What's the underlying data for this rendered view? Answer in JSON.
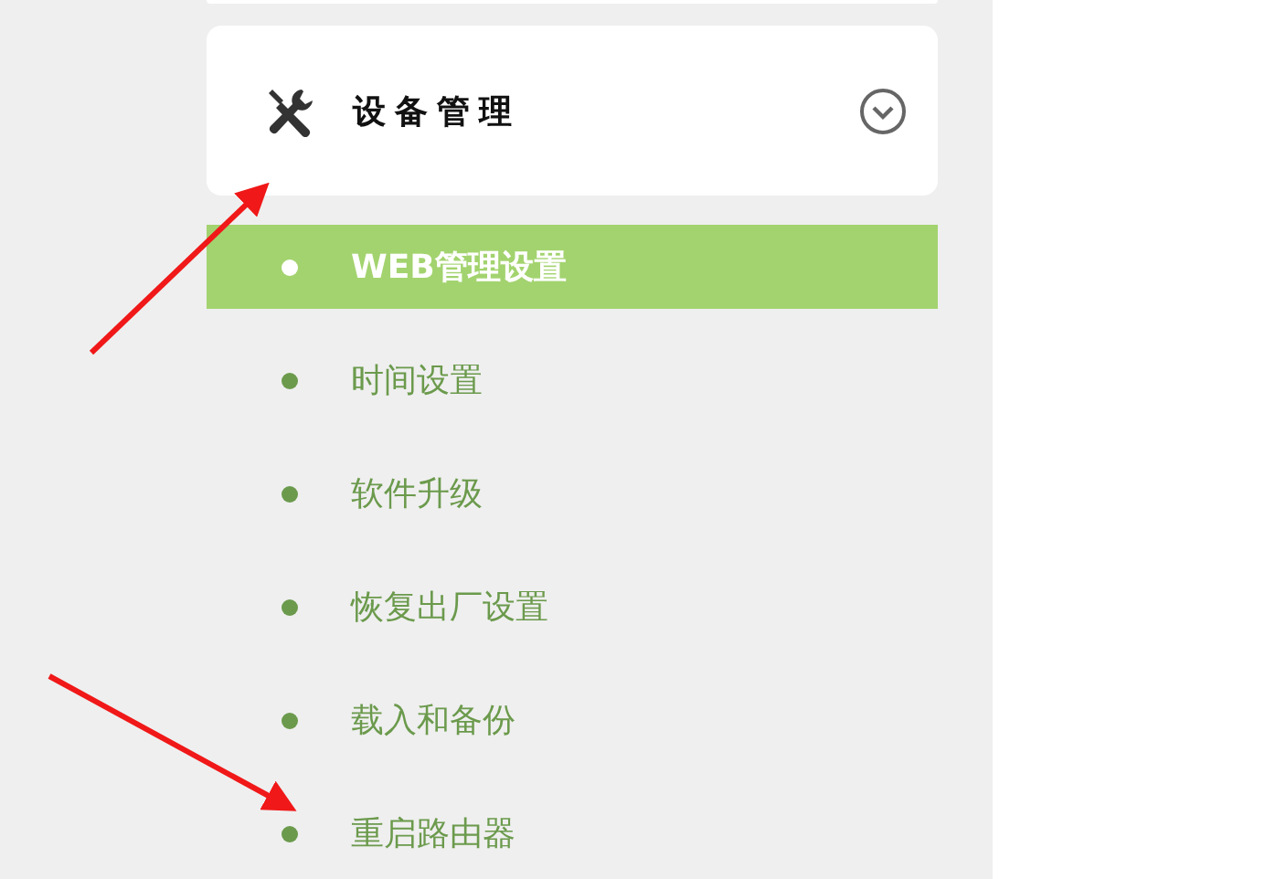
{
  "menu": {
    "title": "设备管理",
    "expanded": true,
    "items": [
      {
        "label": "WEB管理设置",
        "selected": true
      },
      {
        "label": "时间设置",
        "selected": false
      },
      {
        "label": "软件升级",
        "selected": false
      },
      {
        "label": "恢复出厂设置",
        "selected": false
      },
      {
        "label": "载入和备份",
        "selected": false
      },
      {
        "label": "重启路由器",
        "selected": false
      }
    ]
  }
}
